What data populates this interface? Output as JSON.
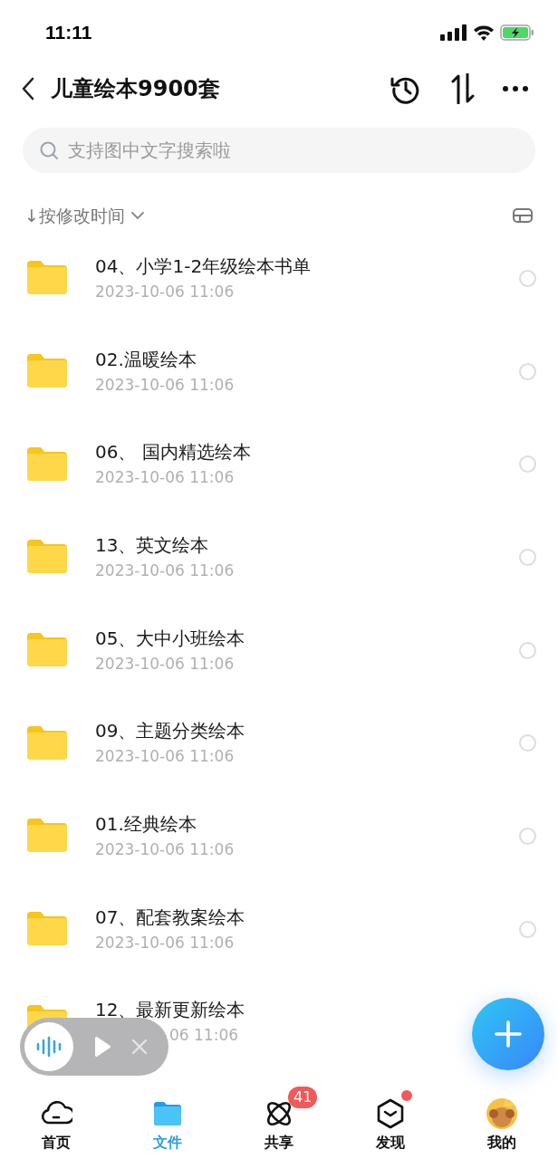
{
  "status_bar": {
    "time": "11:11"
  },
  "header": {
    "title": "儿童绘本9900套"
  },
  "search": {
    "placeholder": "支持图中文字搜索啦"
  },
  "sort": {
    "label": "↓按修改时间"
  },
  "files": [
    {
      "name": "04、小学1-2年级绘本书单",
      "date": "2023-10-06 11:06",
      "selected": false
    },
    {
      "name": "02.温暖绘本",
      "date": "2023-10-06 11:06",
      "selected": false
    },
    {
      "name": "06、 国内精选绘本",
      "date": "2023-10-06 11:06",
      "selected": false
    },
    {
      "name": "13、英文绘本",
      "date": "2023-10-06 11:06",
      "selected": false
    },
    {
      "name": "05、大中小班绘本",
      "date": "2023-10-06 11:06",
      "selected": false
    },
    {
      "name": "09、主题分类绘本",
      "date": "2023-10-06 11:06",
      "selected": false
    },
    {
      "name": "01.经典绘本",
      "date": "2023-10-06 11:06",
      "selected": false
    },
    {
      "name": "07、配套教案绘本",
      "date": "2023-10-06 11:06",
      "selected": false
    },
    {
      "name": "12、最新更新绘本",
      "date": "06 11:06",
      "covered": true
    }
  ],
  "tabs": [
    {
      "kind": "cloud",
      "label": "首页",
      "selected": false
    },
    {
      "kind": "folder",
      "label": "文件",
      "selected": true
    },
    {
      "kind": "orbit",
      "label": "共享",
      "selected": false,
      "badge": "41"
    },
    {
      "kind": "cube",
      "label": "发现",
      "selected": false,
      "dot": true
    },
    {
      "kind": "avatar",
      "label": "我的",
      "selected": false
    }
  ]
}
